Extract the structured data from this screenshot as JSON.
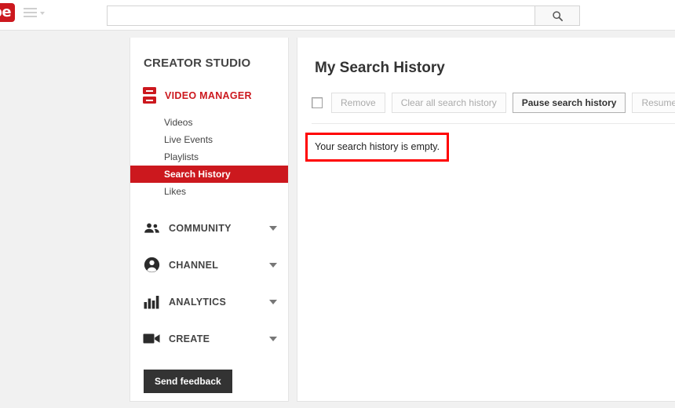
{
  "masthead": {
    "logo_text": "be",
    "logo_icon": "youtube-logo",
    "guide_icon": "hamburger-menu-icon",
    "search": {
      "value": "",
      "placeholder": "",
      "submit_icon": "search-icon"
    }
  },
  "sidebar": {
    "title": "CREATOR STUDIO",
    "video_manager": {
      "label": "VIDEO MANAGER",
      "icon": "video-manager-icon"
    },
    "subitems": [
      {
        "label": "Videos",
        "active": false
      },
      {
        "label": "Live Events",
        "active": false
      },
      {
        "label": "Playlists",
        "active": false
      },
      {
        "label": "Search History",
        "active": true
      },
      {
        "label": "Likes",
        "active": false
      }
    ],
    "sections": [
      {
        "label": "COMMUNITY",
        "icon": "people-icon",
        "chevron": "chevron-down-icon"
      },
      {
        "label": "CHANNEL",
        "icon": "account-circle-icon",
        "chevron": "chevron-down-icon"
      },
      {
        "label": "ANALYTICS",
        "icon": "bar-chart-icon",
        "chevron": "chevron-down-icon"
      },
      {
        "label": "CREATE",
        "icon": "video-camera-icon",
        "chevron": "chevron-down-icon"
      }
    ],
    "send_feedback_label": "Send feedback"
  },
  "main": {
    "page_title": "My Search History",
    "toolbar": {
      "select_all_checked": false,
      "buttons": [
        {
          "label": "Remove",
          "enabled": false
        },
        {
          "label": "Clear all search history",
          "enabled": false
        },
        {
          "label": "Pause search history",
          "enabled": true
        },
        {
          "label": "Resume search history",
          "enabled": false
        }
      ]
    },
    "empty_message": "Your search history is empty."
  },
  "colors": {
    "brand_red": "#cc181e",
    "highlight_red": "#ff0000",
    "page_background": "#f1f1f1",
    "panel_background": "#ffffff",
    "dark_button": "#333333"
  }
}
